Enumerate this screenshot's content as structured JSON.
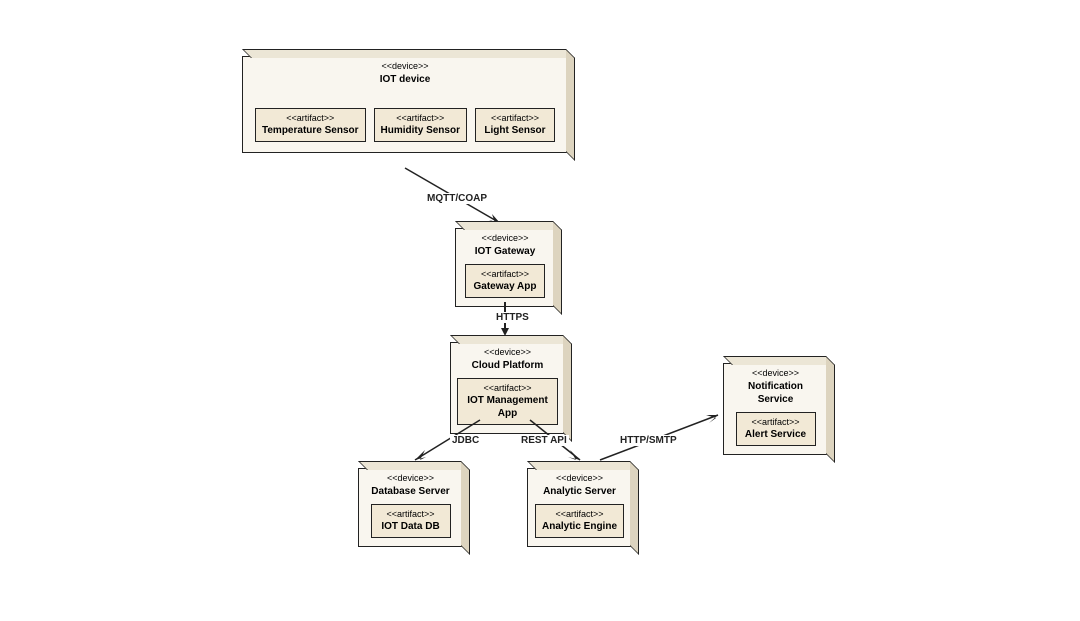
{
  "nodes": {
    "iot_device": {
      "stereo": "<<device>>",
      "name": "IOT device",
      "artifacts": [
        {
          "stereo": "<<artifact>>",
          "name": "Temperature Sensor"
        },
        {
          "stereo": "<<artifact>>",
          "name": "Humidity Sensor"
        },
        {
          "stereo": "<<artifact>>",
          "name": "Light Sensor"
        }
      ]
    },
    "iot_gateway": {
      "stereo": "<<device>>",
      "name": "IOT Gateway",
      "artifacts": [
        {
          "stereo": "<<artifact>>",
          "name": "Gateway App"
        }
      ]
    },
    "cloud_platform": {
      "stereo": "<<device>>",
      "name": "Cloud Platform",
      "artifacts": [
        {
          "stereo": "<<artifact>>",
          "name": "IOT Management App"
        }
      ]
    },
    "notification_service": {
      "stereo": "<<device>>",
      "name": "Notification Service",
      "artifacts": [
        {
          "stereo": "<<artifact>>",
          "name": "Alert Service"
        }
      ]
    },
    "database_server": {
      "stereo": "<<device>>",
      "name": "Database Server",
      "artifacts": [
        {
          "stereo": "<<artifact>>",
          "name": "IOT Data DB"
        }
      ]
    },
    "analytic_server": {
      "stereo": "<<device>>",
      "name": "Analytic Server",
      "artifacts": [
        {
          "stereo": "<<artifact>>",
          "name": "Analytic Engine"
        }
      ]
    }
  },
  "edges": {
    "e1": "MQTT/COAP",
    "e2": "HTTPS",
    "e3": "JDBC",
    "e4": "REST API",
    "e5": "HTTP/SMTP"
  }
}
